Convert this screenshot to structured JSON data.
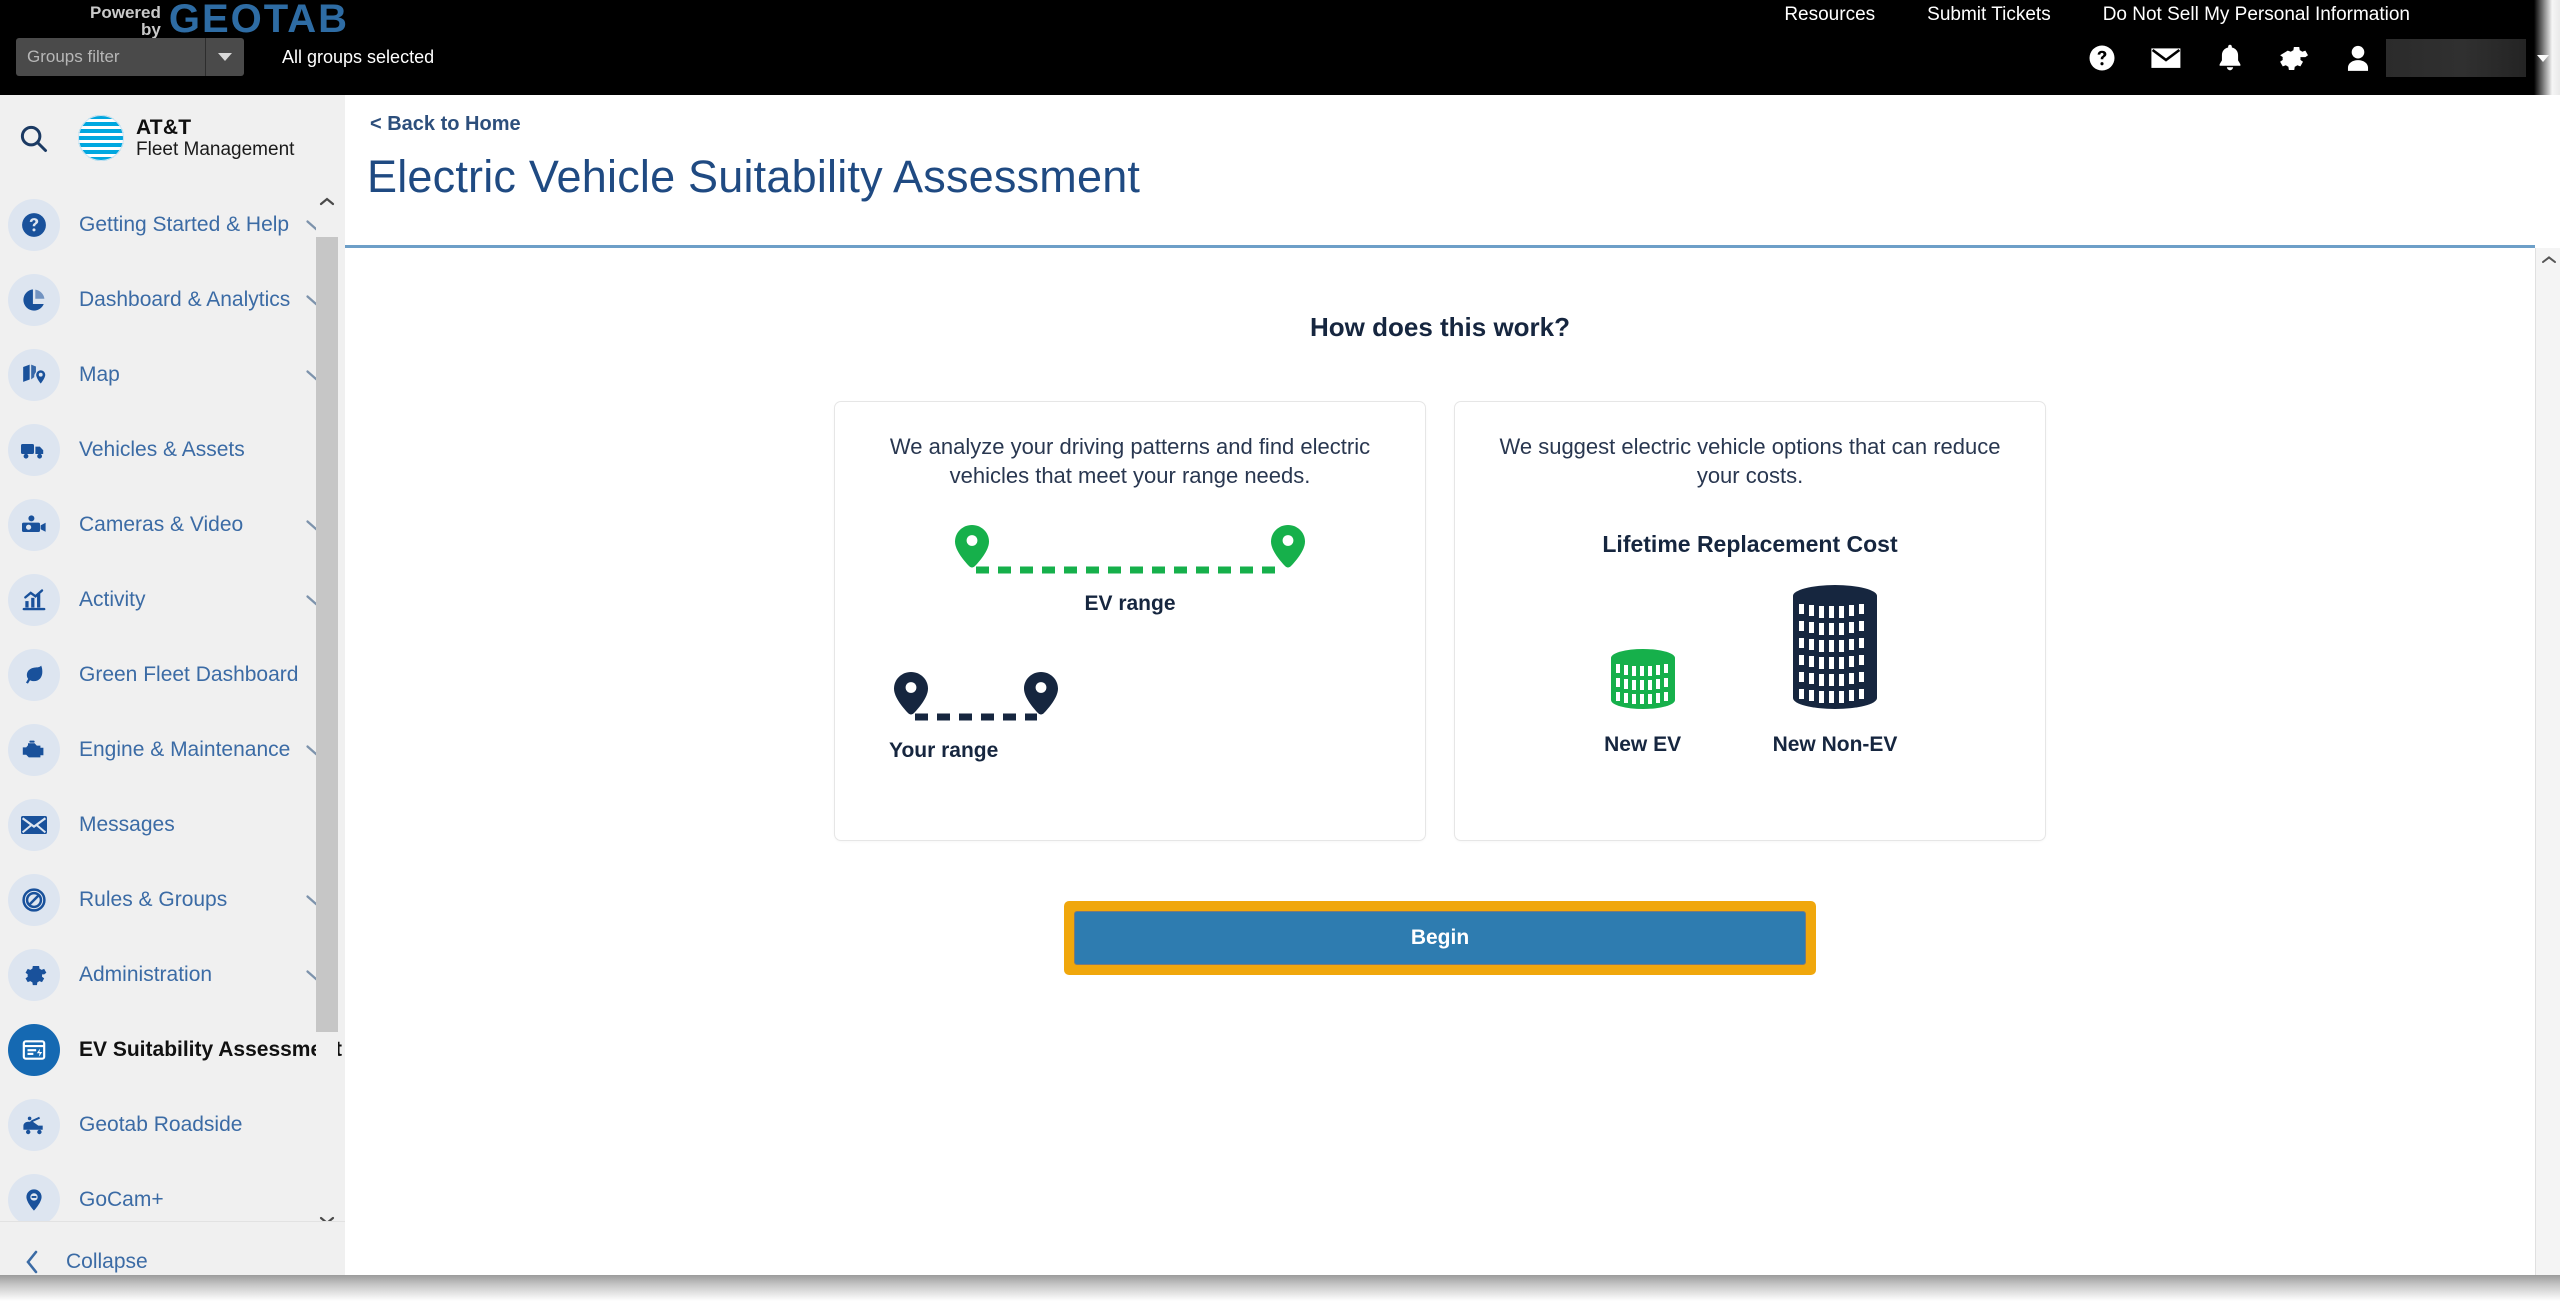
{
  "topbar": {
    "powered_by_line1": "Powered",
    "powered_by_line2": "by",
    "brand": "GEOTAB",
    "links": [
      {
        "label": "Resources"
      },
      {
        "label": "Submit Tickets"
      },
      {
        "label": "Do Not Sell My Personal Information"
      }
    ],
    "groups_filter_placeholder": "Groups filter",
    "groups_selected_text": "All groups selected",
    "icons": [
      {
        "name": "help-icon"
      },
      {
        "name": "mail-icon"
      },
      {
        "name": "bell-icon"
      },
      {
        "name": "gear-icon"
      },
      {
        "name": "user-icon"
      }
    ]
  },
  "sidebar": {
    "search_icon": "search-icon",
    "brand_line1": "AT&T",
    "brand_line2": "Fleet Management",
    "items": [
      {
        "label": "Getting Started & Help",
        "icon": "question-circle-icon",
        "expandable": true,
        "active": false
      },
      {
        "label": "Dashboard & Analytics",
        "icon": "pie-chart-icon",
        "expandable": true,
        "active": false
      },
      {
        "label": "Map",
        "icon": "map-pin-icon",
        "expandable": true,
        "active": false
      },
      {
        "label": "Vehicles & Assets",
        "icon": "truck-icon",
        "expandable": false,
        "active": false
      },
      {
        "label": "Cameras & Video",
        "icon": "camera-icon",
        "expandable": true,
        "active": false
      },
      {
        "label": "Activity",
        "icon": "bar-chart-icon",
        "expandable": true,
        "active": false
      },
      {
        "label": "Green Fleet Dashboard",
        "icon": "leaf-icon",
        "expandable": false,
        "active": false
      },
      {
        "label": "Engine & Maintenance",
        "icon": "engine-icon",
        "expandable": true,
        "active": false
      },
      {
        "label": "Messages",
        "icon": "envelope-icon",
        "expandable": false,
        "active": false
      },
      {
        "label": "Rules & Groups",
        "icon": "no-entry-icon",
        "expandable": true,
        "active": false
      },
      {
        "label": "Administration",
        "icon": "gear-icon",
        "expandable": true,
        "active": false
      },
      {
        "label": "EV Suitability Assessment",
        "icon": "ev-assessment-icon",
        "expandable": false,
        "active": true
      },
      {
        "label": "Geotab Roadside",
        "icon": "tow-truck-icon",
        "expandable": false,
        "active": false
      },
      {
        "label": "GoCam+",
        "icon": "camera-pin-icon",
        "expandable": false,
        "active": false
      }
    ],
    "collapse_label": "Collapse"
  },
  "main": {
    "back_link": "< Back to Home",
    "page_title": "Electric Vehicle Suitability Assessment",
    "how_title": "How does this work?",
    "cards": [
      {
        "lead": "We analyze your driving patterns and find electric vehicles that meet your range needs.",
        "ev_range_caption": "EV range",
        "your_range_caption": "Your range"
      },
      {
        "lead": "We suggest electric vehicle options that can reduce your costs.",
        "cost_title": "Lifetime Replacement Cost",
        "new_ev_caption": "New EV",
        "new_non_ev_caption": "New Non-EV"
      }
    ],
    "begin_label": "Begin"
  },
  "colors": {
    "brand_blue": "#1f4a82",
    "geotab_blue": "#2e6ca4",
    "nav_blue": "#3b6ba5",
    "accent_green": "#16b04b",
    "dark_navy": "#16263f",
    "button_blue": "#2e7cb0",
    "focus_orange": "#f0a70c"
  }
}
